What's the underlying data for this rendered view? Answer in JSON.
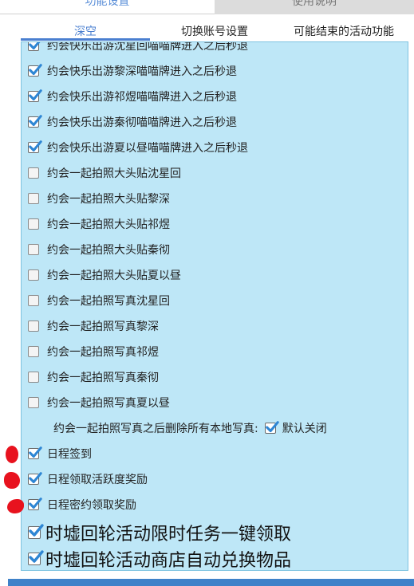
{
  "top_tabs": [
    {
      "label": "功能设置",
      "active": true
    },
    {
      "label": "使用说明",
      "active": false
    }
  ],
  "sub_tabs": [
    {
      "label": "深空",
      "active": true
    },
    {
      "label": "切换账号设置",
      "active": false
    },
    {
      "label": "可能结束的活动功能",
      "active": false
    }
  ],
  "rows": [
    {
      "label": "约会快乐出游沈星回喵喵牌进入之后秒退",
      "checked": true
    },
    {
      "label": "约会快乐出游黎深喵喵牌进入之后秒退",
      "checked": true
    },
    {
      "label": "约会快乐出游祁煜喵喵牌进入之后秒退",
      "checked": true
    },
    {
      "label": "约会快乐出游秦彻喵喵牌进入之后秒退",
      "checked": true
    },
    {
      "label": "约会快乐出游夏以昼喵喵牌进入之后秒退",
      "checked": true
    },
    {
      "label": "约会一起拍照大头贴沈星回",
      "checked": false
    },
    {
      "label": "约会一起拍照大头贴黎深",
      "checked": false
    },
    {
      "label": "约会一起拍照大头贴祁煜",
      "checked": false
    },
    {
      "label": "约会一起拍照大头贴秦彻",
      "checked": false
    },
    {
      "label": "约会一起拍照大头贴夏以昼",
      "checked": false
    },
    {
      "label": "约会一起拍照写真沈星回",
      "checked": false
    },
    {
      "label": "约会一起拍照写真黎深",
      "checked": false
    },
    {
      "label": "约会一起拍照写真祁煜",
      "checked": false
    },
    {
      "label": "约会一起拍照写真秦彻",
      "checked": false
    },
    {
      "label": "约会一起拍照写真夏以昼",
      "checked": false
    }
  ],
  "delete_photos": {
    "label": "约会一起拍照写真之后删除所有本地写真:",
    "checked": true,
    "option_label": "默认关闭"
  },
  "schedule_rows": [
    {
      "label": "日程签到",
      "checked": true
    },
    {
      "label": "日程领取活跃度奖励",
      "checked": true
    },
    {
      "label": "日程密约领取奖励",
      "checked": true
    }
  ],
  "event_rows": [
    {
      "label": "时墟回轮活动限时任务一键领取",
      "checked": true
    },
    {
      "label": "时墟回轮活动商店自动兑换物品",
      "checked": true
    }
  ],
  "colors": {
    "panel_bg": "#bee7f7",
    "accent": "#4a7fd0",
    "check": "#2e86d4",
    "annotation_red": "#e8121e"
  }
}
